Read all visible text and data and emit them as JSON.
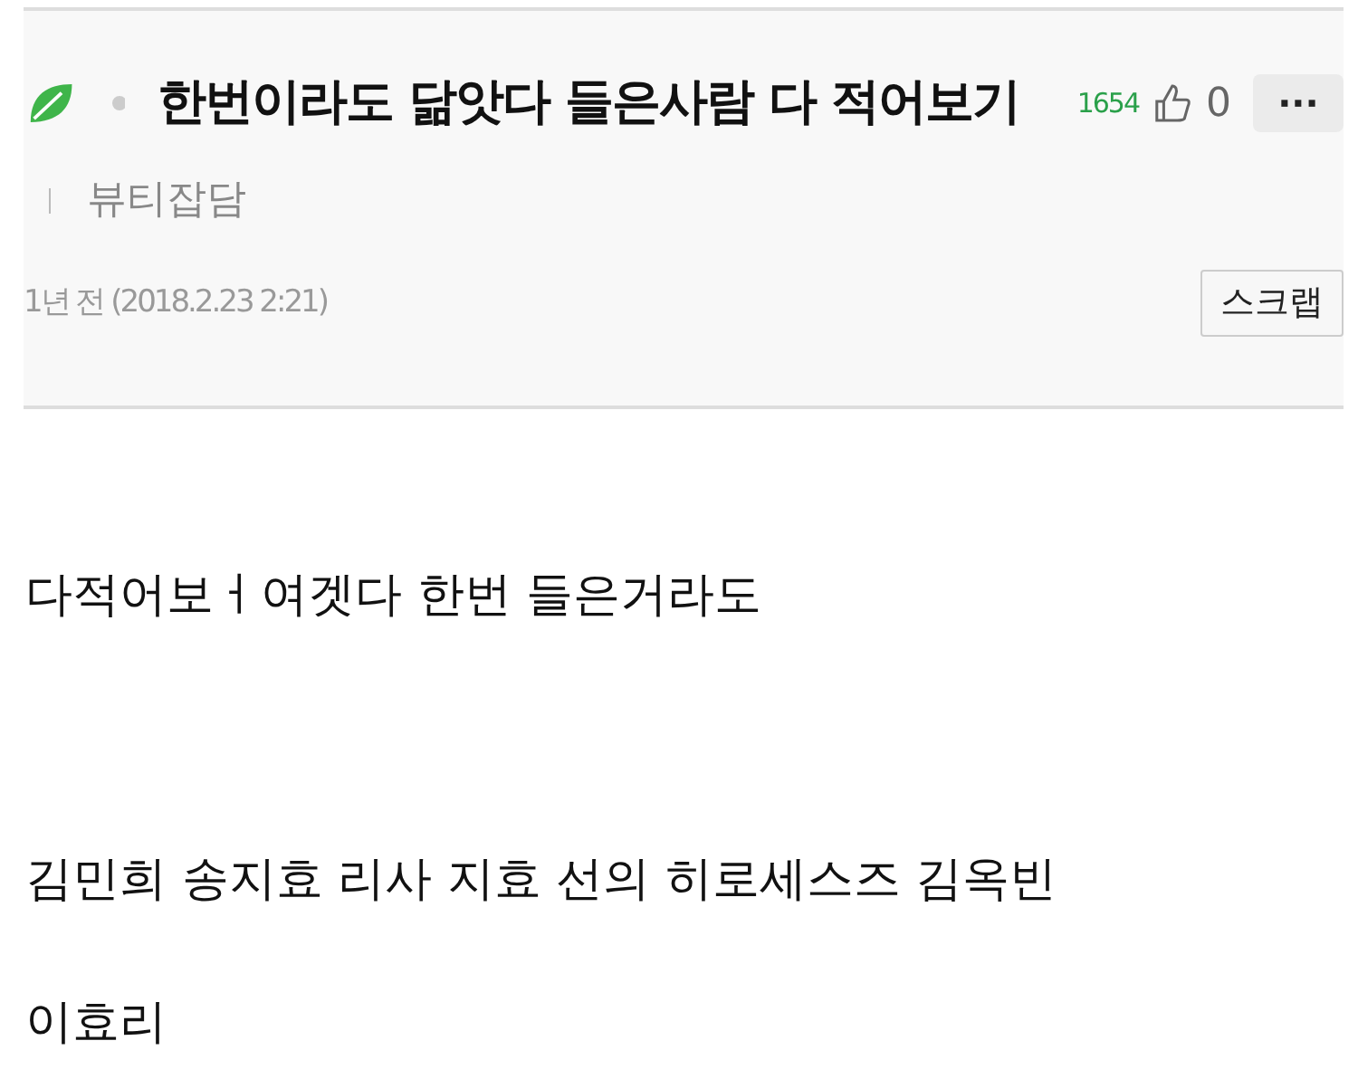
{
  "post": {
    "title": "한번이라도 닮앗다 들은사람 다 적어보기",
    "views": "1654",
    "likes": "0",
    "more": "···",
    "category": "뷰티잡담",
    "date": "1년 전 (2018.2.23 2:21)",
    "scrap_button": "스크랩"
  },
  "body": [
    "다적어보ㅓ여겟다 한번 들은거라도",
    "김민희 송지효 리사 지효 선의 히로세스즈 김옥빈",
    "이효리"
  ]
}
